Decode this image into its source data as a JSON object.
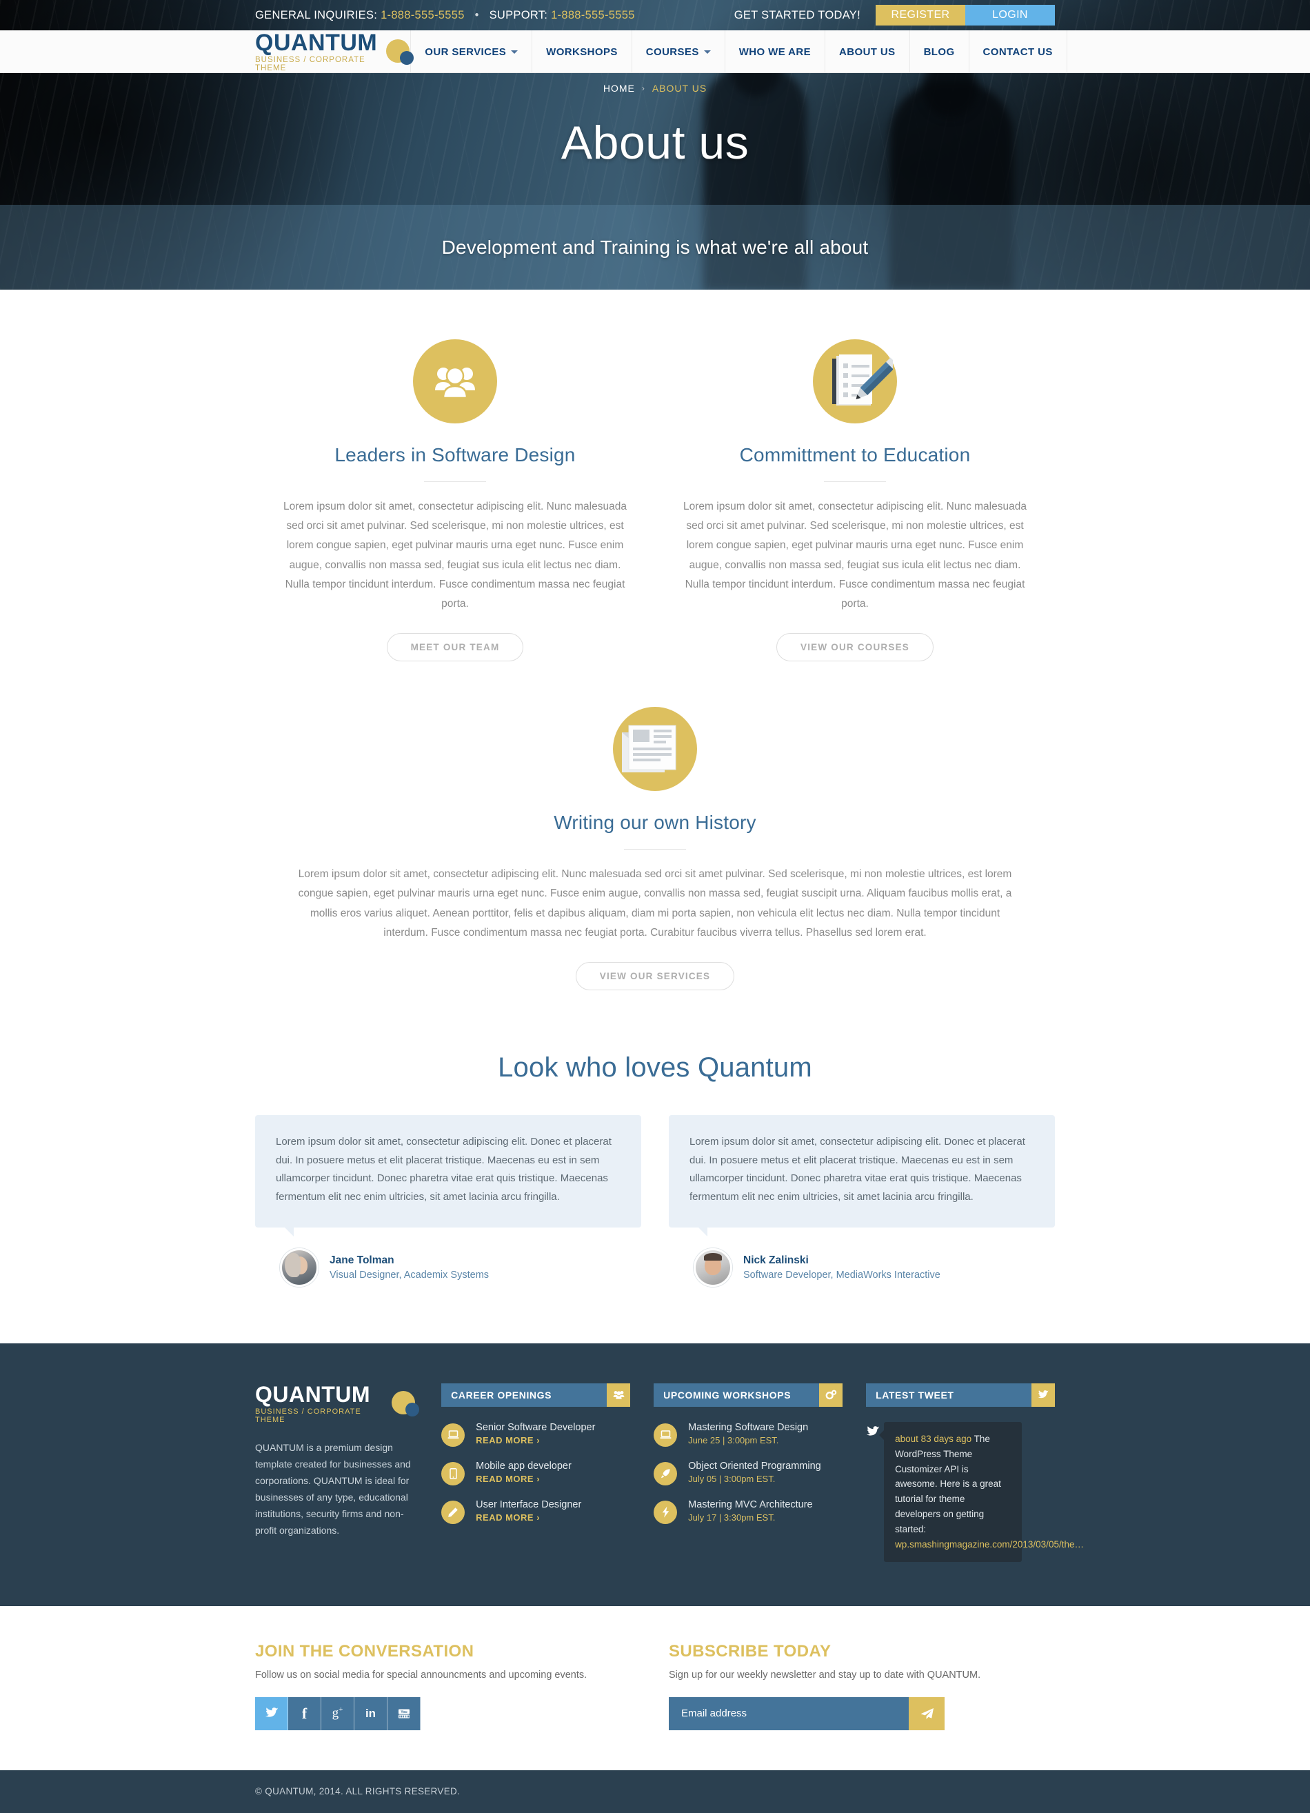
{
  "topbar": {
    "general_label": "GENERAL INQUIRIES:",
    "general_number": "1-888-555-5555",
    "separator": "•",
    "support_label": "SUPPORT:",
    "support_number": "1-888-555-5555",
    "get_started": "GET STARTED TODAY!",
    "register": "REGISTER",
    "login": "LOGIN",
    "register_color": "#ddc05f",
    "login_color": "#62b3e8"
  },
  "logo": {
    "name": "QUANTUM",
    "tagline": "BUSINESS / CORPORATE THEME"
  },
  "nav": {
    "items": [
      {
        "label": "OUR SERVICES",
        "has_caret": true
      },
      {
        "label": "WORKSHOPS",
        "has_caret": false
      },
      {
        "label": "COURSES",
        "has_caret": true
      },
      {
        "label": "WHO WE ARE",
        "has_caret": false
      },
      {
        "label": "ABOUT US",
        "has_caret": false
      },
      {
        "label": "BLOG",
        "has_caret": false
      },
      {
        "label": "CONTACT US",
        "has_caret": false
      }
    ]
  },
  "hero": {
    "breadcrumb_home": "HOME",
    "breadcrumb_arrow": "›",
    "breadcrumb_current": "ABOUT US",
    "title": "About us",
    "subtitle": "Development and Training is what we're all about"
  },
  "features": [
    {
      "icon": "people-group-icon",
      "title": "Leaders in Software Design",
      "body": "Lorem ipsum dolor sit amet, consectetur adipiscing elit. Nunc malesuada sed orci sit amet pulvinar. Sed scelerisque, mi non molestie ultrices, est lorem congue sapien, eget pulvinar mauris urna eget nunc. Fusce enim augue, convallis non massa sed, feugiat sus icula elit lectus nec diam. Nulla tempor tincidunt interdum. Fusce condimentum massa nec feugiat porta.",
      "button": "MEET OUR TEAM"
    },
    {
      "icon": "document-pencil-icon",
      "title": "Committment to Education",
      "body": "Lorem ipsum dolor sit amet, consectetur adipiscing elit. Nunc malesuada sed orci sit amet pulvinar. Sed scelerisque, mi non molestie ultrices, est lorem congue sapien, eget pulvinar mauris urna eget nunc. Fusce enim augue, convallis non massa sed, feugiat sus icula elit lectus nec diam. Nulla tempor tincidunt interdum. Fusce condimentum massa nec feugiat porta.",
      "button": "VIEW OUR COURSES"
    }
  ],
  "feature_wide": {
    "icon": "newspaper-icon",
    "title": "Writing our own History",
    "body": "Lorem ipsum dolor sit amet, consectetur adipiscing elit. Nunc malesuada sed orci sit amet pulvinar. Sed scelerisque, mi non molestie ultrices, est lorem congue sapien, eget pulvinar mauris urna eget nunc. Fusce enim augue, convallis non massa sed, feugiat suscipit urna. Aliquam faucibus mollis erat, a mollis eros varius aliquet. Aenean porttitor, felis et dapibus aliquam, diam mi porta sapien, non vehicula elit lectus nec diam. Nulla tempor tincidunt interdum. Fusce condimentum massa nec feugiat porta. Curabitur faucibus viverra tellus. Phasellus sed lorem erat.",
    "button": "VIEW OUR SERVICES"
  },
  "testimonials": {
    "heading": "Look who loves Quantum",
    "items": [
      {
        "quote": "Lorem ipsum dolor sit amet, consectetur adipiscing elit. Donec et placerat dui. In posuere metus et elit placerat tristique. Maecenas eu est in sem ullamcorper tincidunt. Donec pharetra vitae erat quis tristique. Maecenas fermentum elit nec enim ultricies, sit amet lacinia arcu fringilla.",
        "name": "Jane Tolman",
        "role": "Visual Designer, Academix Systems",
        "avatar": "avatar-female"
      },
      {
        "quote": "Lorem ipsum dolor sit amet, consectetur adipiscing elit. Donec et placerat dui. In posuere metus et elit placerat tristique. Maecenas eu est in sem ullamcorper tincidunt. Donec pharetra vitae erat quis tristique. Maecenas fermentum elit nec enim ultricies, sit amet lacinia arcu fringilla.",
        "name": "Nick Zalinski",
        "role": "Software Developer, MediaWorks Interactive",
        "avatar": "avatar-male"
      }
    ]
  },
  "footer": {
    "about": {
      "logo_name": "QUANTUM",
      "logo_tagline": "BUSINESS / CORPORATE THEME",
      "text": "QUANTUM is a premium design template created for  businesses and corporations. QUANTUM is ideal for  businesses of any type, educational institutions, security firms and non-profit organizations."
    },
    "careers": {
      "title": "CAREER OPENINGS",
      "header_icon": "people-group-icon",
      "items": [
        {
          "icon": "laptop-icon",
          "title": "Senior Software Developer",
          "link": "READ MORE ›"
        },
        {
          "icon": "mobile-icon",
          "title": "Mobile app developer",
          "link": "READ MORE ›"
        },
        {
          "icon": "pencil-icon",
          "title": "User Interface Designer",
          "link": "READ MORE ›"
        }
      ]
    },
    "workshops": {
      "title": "UPCOMING WORKSHOPS",
      "header_icon": "gears-icon",
      "items": [
        {
          "icon": "laptop-icon",
          "title": "Mastering Software Design",
          "meta": "June 25 | 3:00pm EST."
        },
        {
          "icon": "rocket-icon",
          "title": "Object Oriented Programming",
          "meta": "July 05 | 3:00pm EST."
        },
        {
          "icon": "bolt-icon",
          "title": "Mastering MVC Architecture",
          "meta": "July 17 | 3:30pm EST."
        }
      ]
    },
    "tweet": {
      "title": "LATEST TWEET",
      "header_icon": "twitter-icon",
      "time": "about 83 days ago",
      "text": " The WordPress Theme Customizer API is awesome. Here is a great tutorial for theme developers on getting started: ",
      "link": "wp.smashingmagazine.com/2013/03/05/the…"
    }
  },
  "subscribe": {
    "social_heading": "JOIN THE CONVERSATION",
    "social_sub": "Follow us on social media for special announcments and upcoming events.",
    "social_icons": [
      {
        "name": "twitter-icon",
        "glyph": "🐦",
        "accent": true
      },
      {
        "name": "facebook-icon",
        "glyph": "f",
        "accent": false
      },
      {
        "name": "google-plus-icon",
        "glyph": "g+",
        "accent": false
      },
      {
        "name": "linkedin-icon",
        "glyph": "in",
        "accent": false
      },
      {
        "name": "youtube-icon",
        "glyph": "▶",
        "accent": false
      }
    ],
    "news_heading": "SUBSCRIBE TODAY",
    "news_sub": "Sign up for our weekly newsletter and stay up to date with QUANTUM.",
    "email_placeholder": "Email address",
    "email_value": "",
    "send_icon": "paper-plane-icon"
  },
  "copyright": "© QUANTUM, 2014. ALL RIGHTS RESERVED."
}
